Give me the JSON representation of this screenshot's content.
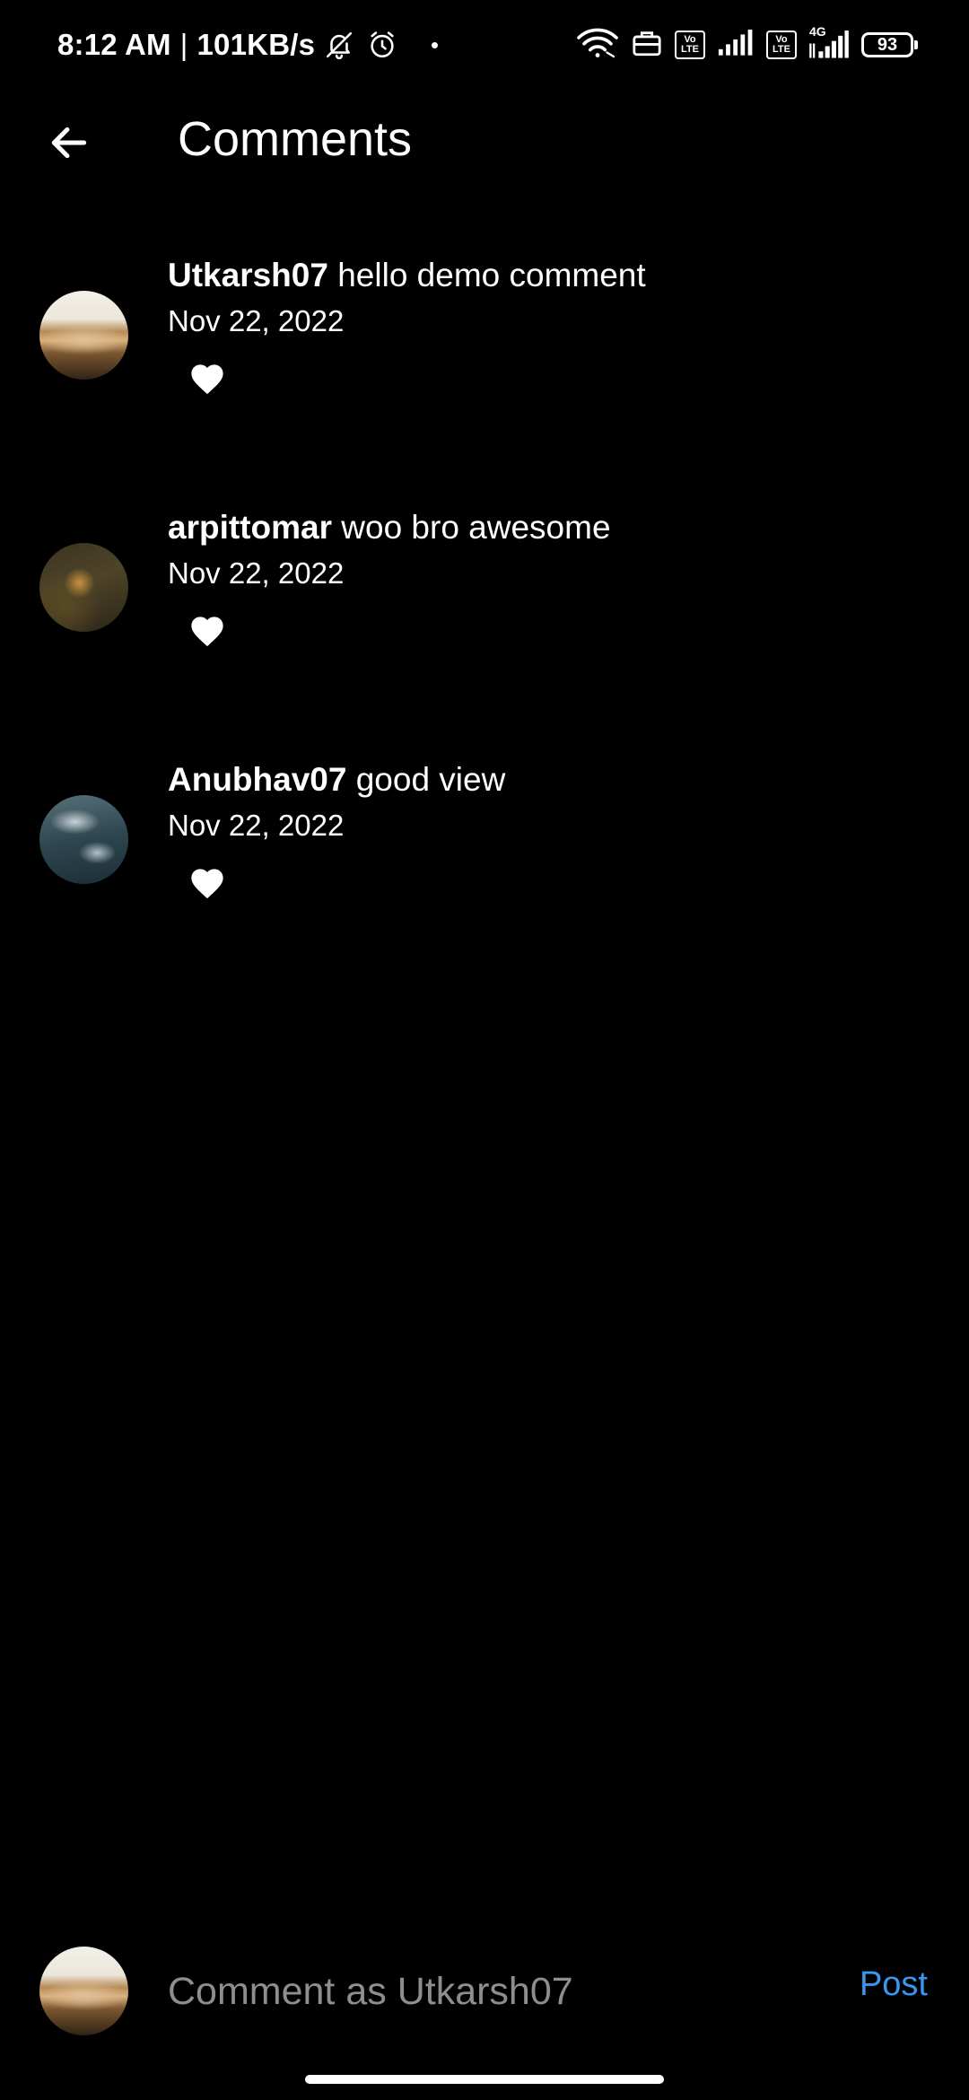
{
  "status_bar": {
    "time": "8:12 AM",
    "separator": "|",
    "speed": "101KB/s",
    "network_gen": "4G",
    "volte_top": "Vo",
    "volte_bottom": "LTE",
    "battery": "93",
    "icons": [
      "bell-muted-icon",
      "alarm-icon",
      "dot-icon",
      "wifi-icon",
      "briefcase-icon",
      "volte-icon",
      "signal-icon",
      "volte-icon",
      "signal-icon",
      "battery-icon"
    ]
  },
  "header": {
    "title": "Comments",
    "back_icon": "arrow-left-icon"
  },
  "comments": [
    {
      "username": "Utkarsh07",
      "text": "hello demo comment",
      "date": "Nov 22, 2022",
      "avatar": "desert-photo",
      "like_icon": "heart-icon"
    },
    {
      "username": "arpittomar",
      "text": "woo bro awesome",
      "date": "Nov 22, 2022",
      "avatar": "grass-photo",
      "like_icon": "heart-icon"
    },
    {
      "username": "Anubhav07",
      "text": "good view",
      "date": "Nov 22, 2022",
      "avatar": "ocean-photo",
      "like_icon": "heart-icon"
    }
  ],
  "composer": {
    "placeholder": "Comment as Utkarsh07",
    "value": "",
    "post_label": "Post"
  },
  "colors": {
    "background": "#000000",
    "text": "#ffffff",
    "placeholder": "#8e8e8e",
    "accent": "#3897f0"
  }
}
